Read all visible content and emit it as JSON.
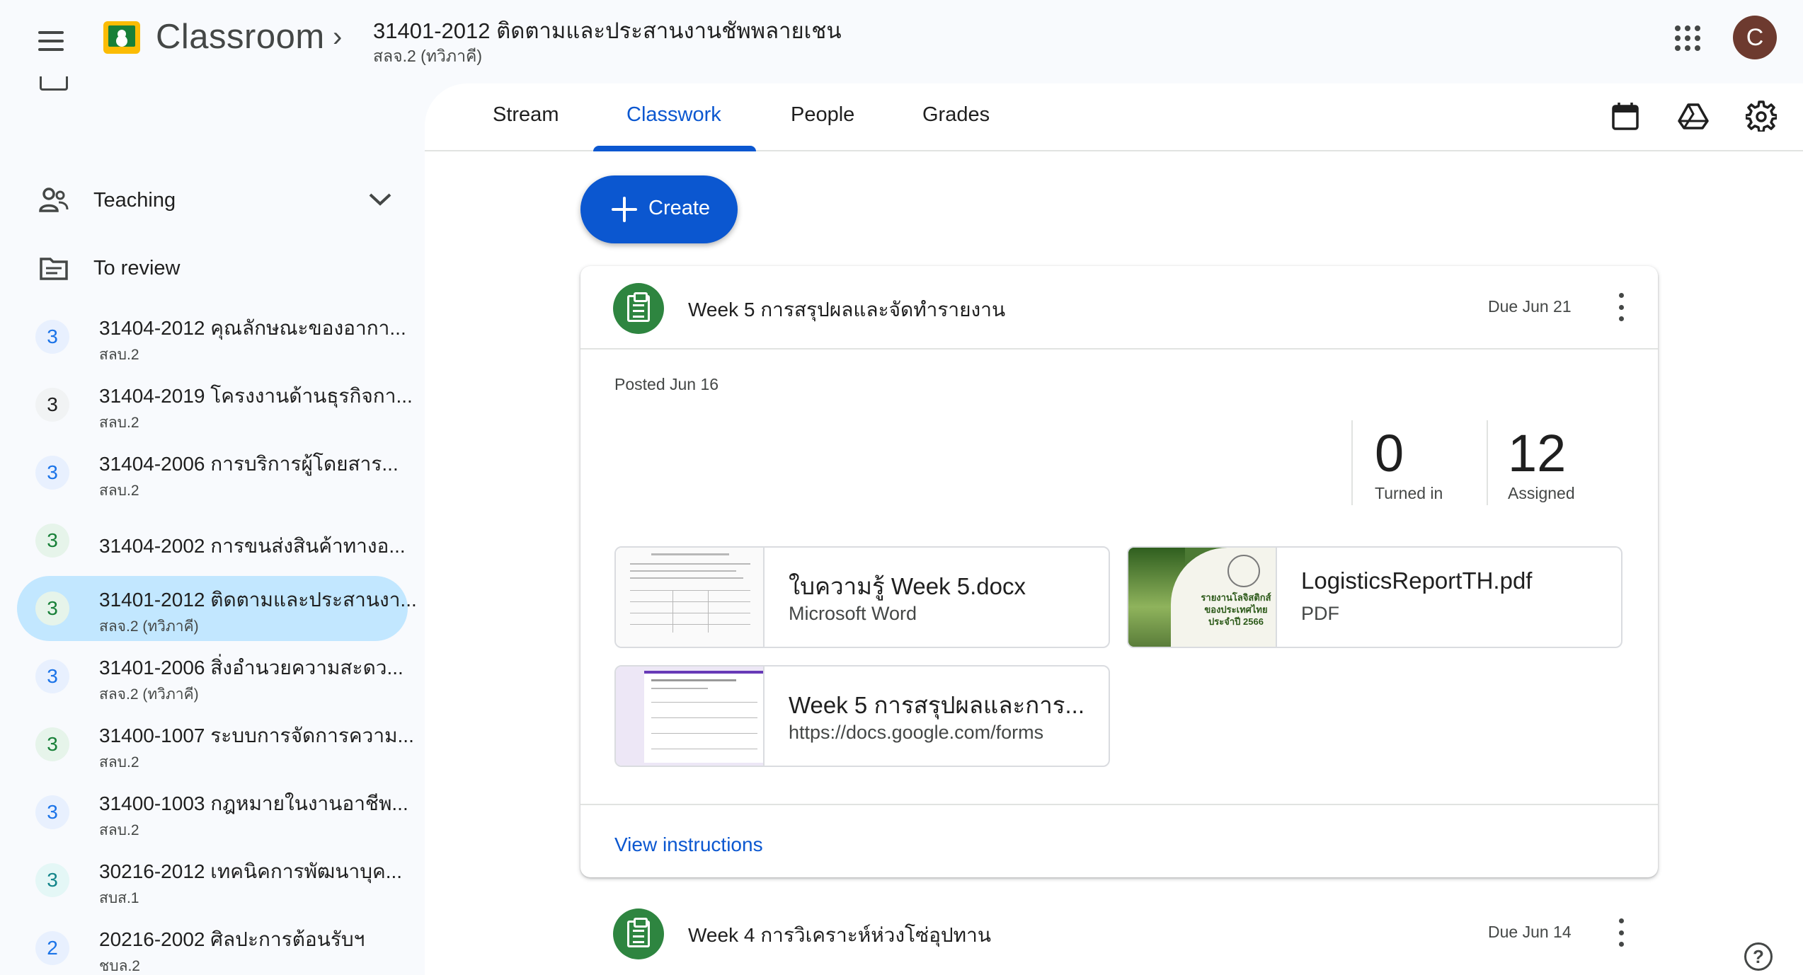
{
  "header": {
    "app_name": "Classroom",
    "class_title": "31401-2012 ติดตามและประสานงานชัพพลายเชน",
    "class_section": "สลจ.2 (ทวิภาคี)",
    "avatar_letter": "C"
  },
  "sidebar": {
    "teaching_label": "Teaching",
    "to_review_label": "To review",
    "classes": [
      {
        "badge": "3",
        "name": "31404-2012 คุณลักษณะของอากา...",
        "section": "สลบ.2",
        "color": "#1a73e8",
        "bg": "#e8f0fe"
      },
      {
        "badge": "3",
        "name": "31404-2019 โครงงานด้านธุรกิจกา...",
        "section": "สลบ.2",
        "color": "#1f1f1f",
        "bg": "#f1f3f4"
      },
      {
        "badge": "3",
        "name": "31404-2006 การบริการผู้โดยสาร...",
        "section": "สลบ.2",
        "color": "#1a73e8",
        "bg": "#e8f0fe"
      },
      {
        "badge": "3",
        "name": "31404-2002 การขนส่งสินค้าทางอ...",
        "section": "",
        "color": "#188038",
        "bg": "#e6f4ea"
      },
      {
        "badge": "3",
        "name": "31401-2012 ติดตามและประสานงา...",
        "section": "สลจ.2 (ทวิภาคี)",
        "color": "#188038",
        "bg": "#e6f4ea"
      },
      {
        "badge": "3",
        "name": "31401-2006 สิ่งอำนวยความสะดว...",
        "section": "สลจ.2 (ทวิภาคี)",
        "color": "#1a73e8",
        "bg": "#e8f0fe"
      },
      {
        "badge": "3",
        "name": "31400-1007 ระบบการจัดการความ...",
        "section": "สลบ.2",
        "color": "#188038",
        "bg": "#e6f4ea"
      },
      {
        "badge": "3",
        "name": "31400-1003 กฎหมายในงานอาชีพ...",
        "section": "สลบ.2",
        "color": "#1a73e8",
        "bg": "#e8f0fe"
      },
      {
        "badge": "3",
        "name": "30216-2012 เทคนิคการพัฒนาบุค...",
        "section": "สบส.1",
        "color": "#12858a",
        "bg": "#e4f7f6"
      },
      {
        "badge": "2",
        "name": "20216-2002 ศิลปะการต้อนรับฯ",
        "section": "ชบล.2",
        "color": "#1a73e8",
        "bg": "#e8f0fe"
      }
    ]
  },
  "tabs": [
    "Stream",
    "Classwork",
    "People",
    "Grades"
  ],
  "create_label": "Create",
  "assignment": {
    "title": "Week 5 การสรุปผลและจัดทำรายงาน",
    "due": "Due Jun 21",
    "posted": "Posted Jun 16",
    "turned_in": "0",
    "turned_in_label": "Turned in",
    "assigned": "12",
    "assigned_label": "Assigned",
    "attachments": [
      {
        "name": "ใบความรู้ Week 5.docx",
        "type": "Microsoft Word"
      },
      {
        "name": "LogisticsReportTH.pdf",
        "type": "PDF",
        "thumb_text": "รายงานโลจิสติกส์ ของประเทศไทย ประจำปี 2566"
      },
      {
        "name": "Week 5 การสรุปผลและการ...",
        "type": "https://docs.google.com/forms"
      }
    ],
    "view_instructions": "View instructions"
  },
  "next_assignment": {
    "title": "Week 4 การวิเคราะห์ห่วงโซ่อุปทาน",
    "due": "Due Jun 14"
  }
}
